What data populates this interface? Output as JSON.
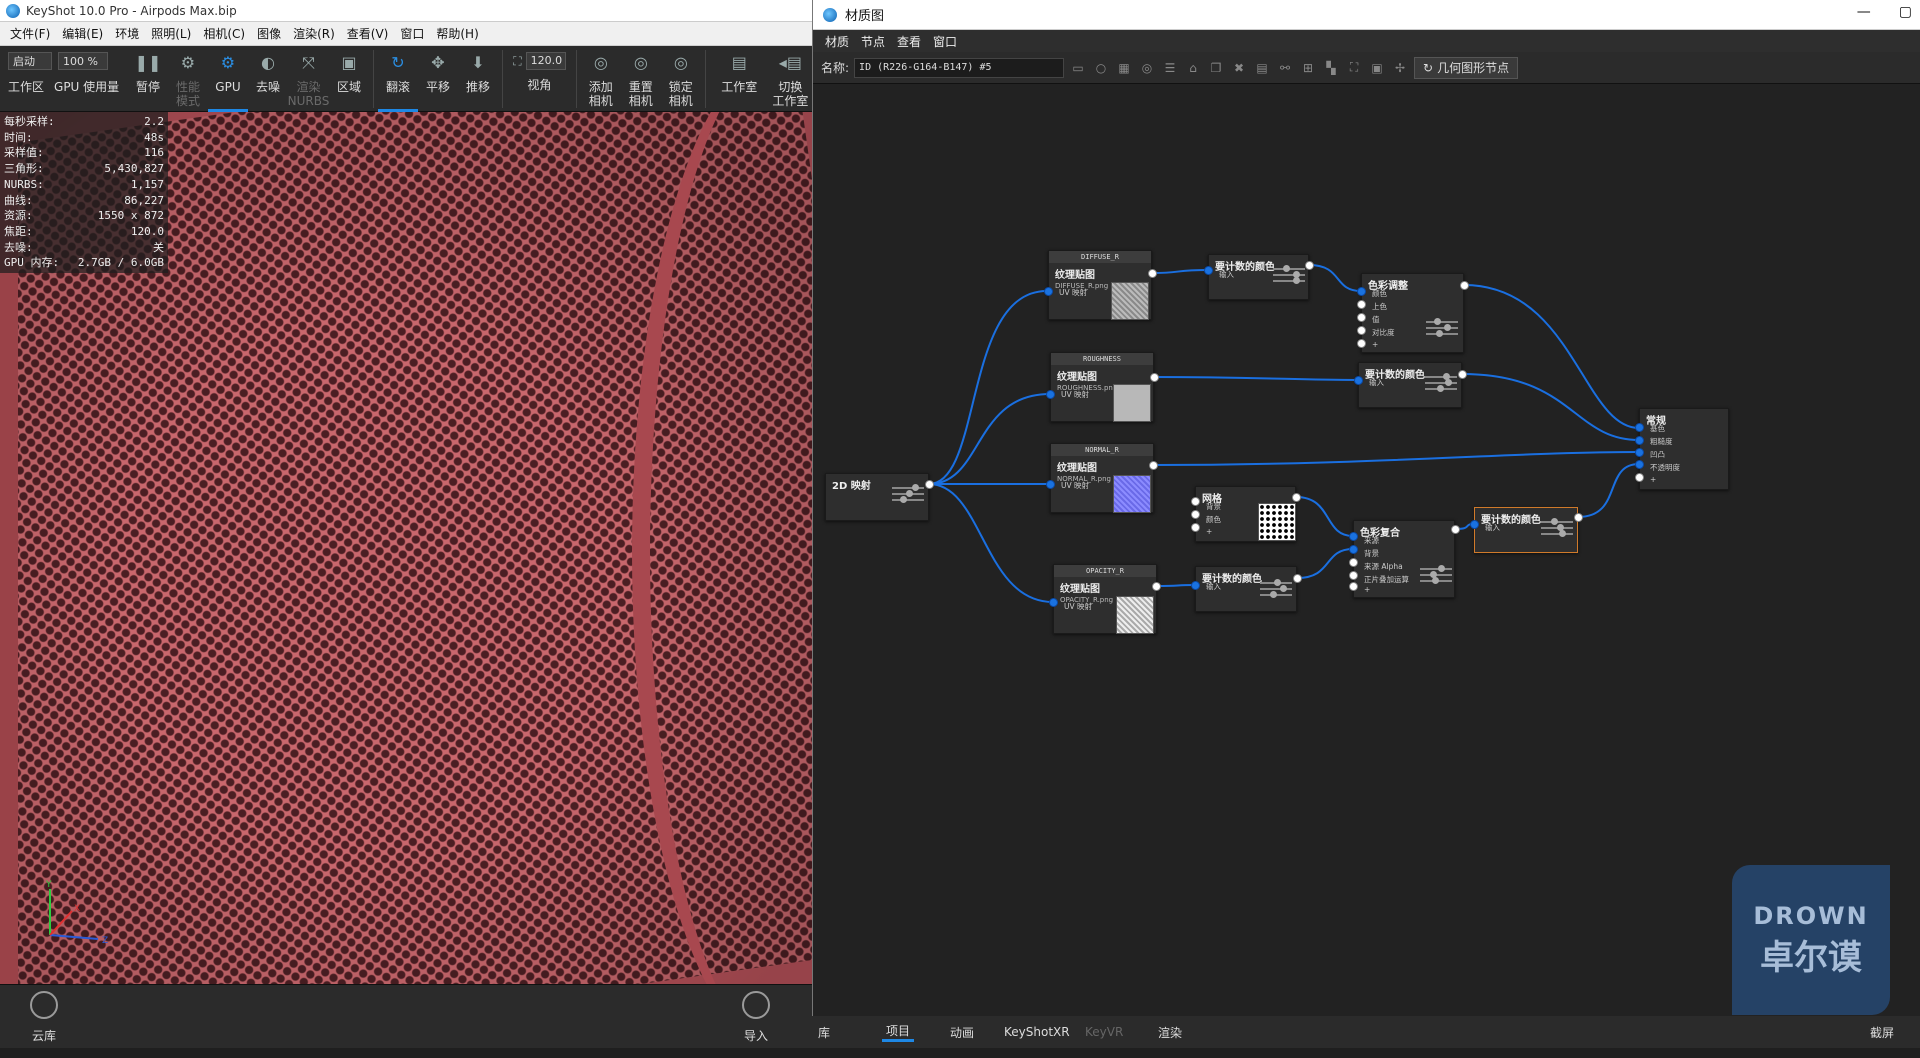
{
  "keyshot": {
    "title": "KeyShot 10.0 Pro  - Airpods Max.bip",
    "menu": [
      "文件(F)",
      "编辑(E)",
      "环境",
      "照明(L)",
      "相机(C)",
      "图像",
      "渲染(R)",
      "查看(V)",
      "窗口",
      "帮助(H)"
    ],
    "toolbar": {
      "start_label": "启动",
      "percent": "100 %",
      "fov_value": "120.0",
      "workspace": "工作区",
      "gpu_usage": "GPU 使用量",
      "pause": "暂停",
      "performance": "性能\n模式",
      "gpu": "GPU",
      "denoise": "去噪",
      "render_nurbs": "渲染\nNURBS",
      "region": "区域",
      "tumble": "翻滚",
      "pan": "平移",
      "dolly": "推移",
      "fov": "视角",
      "add_camera": "添加\n相机",
      "reset_camera": "重置\n相机",
      "lock_camera": "锁定\n相机",
      "studio": "工作室",
      "switch_studio": "切换\n工作室"
    },
    "stats": [
      {
        "k": "每秒采样:",
        "v": "2.2"
      },
      {
        "k": "时间:",
        "v": "48s"
      },
      {
        "k": "采样值:",
        "v": "116"
      },
      {
        "k": "三角形:",
        "v": "5,430,827"
      },
      {
        "k": "NURBS:",
        "v": "1,157"
      },
      {
        "k": "曲线:",
        "v": "86,227"
      },
      {
        "k": "资源:",
        "v": "1550 x 872"
      },
      {
        "k": "焦距:",
        "v": "120.0"
      },
      {
        "k": "去噪:",
        "v": "关"
      },
      {
        "k": "GPU 内存:",
        "v": "2.7GB / 6.0GB"
      }
    ],
    "axis": {
      "y": "Y",
      "x": "X",
      "z": "Z"
    },
    "bottom": {
      "cloud": "云库",
      "import": "导入",
      "library": "库",
      "project": "项目",
      "animation": "动画",
      "keyshotxr": "KeyShotXR",
      "keyvr": "KeyVR",
      "render": "渲染",
      "screenshot": "截屏"
    }
  },
  "material_graph": {
    "title": "材质图",
    "menu": [
      "材质",
      "节点",
      "查看",
      "窗口"
    ],
    "name_label": "名称:",
    "name_value": "ID (R226-G164-B147) #5",
    "geometry_button": "几何图形节点",
    "nodes": {
      "diffuse": {
        "header": "DIFFUSE_R",
        "title": "纹理贴图",
        "file": "DIFFUSE_R.png",
        "pin": "UV 映射"
      },
      "roughness": {
        "header": "ROUGHNESS",
        "title": "纹理贴图",
        "file": "ROUGHNESS.png",
        "pin": "UV 映射"
      },
      "normal": {
        "header": "NORMAL_R",
        "title": "纹理贴图",
        "file": "NORMAL_R.png",
        "pin": "UV 映射"
      },
      "opacity": {
        "header": "OPACITY_R",
        "title": "纹理贴图",
        "file": "OPACITY_R.png",
        "pin": "UV 映射"
      },
      "map2d": {
        "title": "2D 映射"
      },
      "mult1": {
        "title": "要计数的颜色",
        "pin": "输入"
      },
      "mult2": {
        "title": "要计数的颜色",
        "pin": "输入"
      },
      "mult3": {
        "title": "要计数的颜色",
        "pin": "输入"
      },
      "mult4": {
        "title": "要计数的颜色",
        "pin": "输入"
      },
      "color_adjust": {
        "title": "色彩调整",
        "pins": [
          "颜色",
          "上色",
          "值",
          "对比度",
          "+"
        ]
      },
      "mesh": {
        "title": "网格",
        "pins": [
          "背景",
          "颜色",
          "+"
        ]
      },
      "composite": {
        "title": "色彩复合",
        "pins": [
          "来源",
          "背景",
          "来源 Alpha",
          "正片叠加运算",
          "+"
        ]
      },
      "general": {
        "title": "常规",
        "pins": [
          "基色",
          "粗糙度",
          "凹凸",
          "不透明度",
          "+"
        ]
      }
    }
  },
  "watermark": {
    "line1": "DROWN",
    "line2": "卓尔谟"
  }
}
